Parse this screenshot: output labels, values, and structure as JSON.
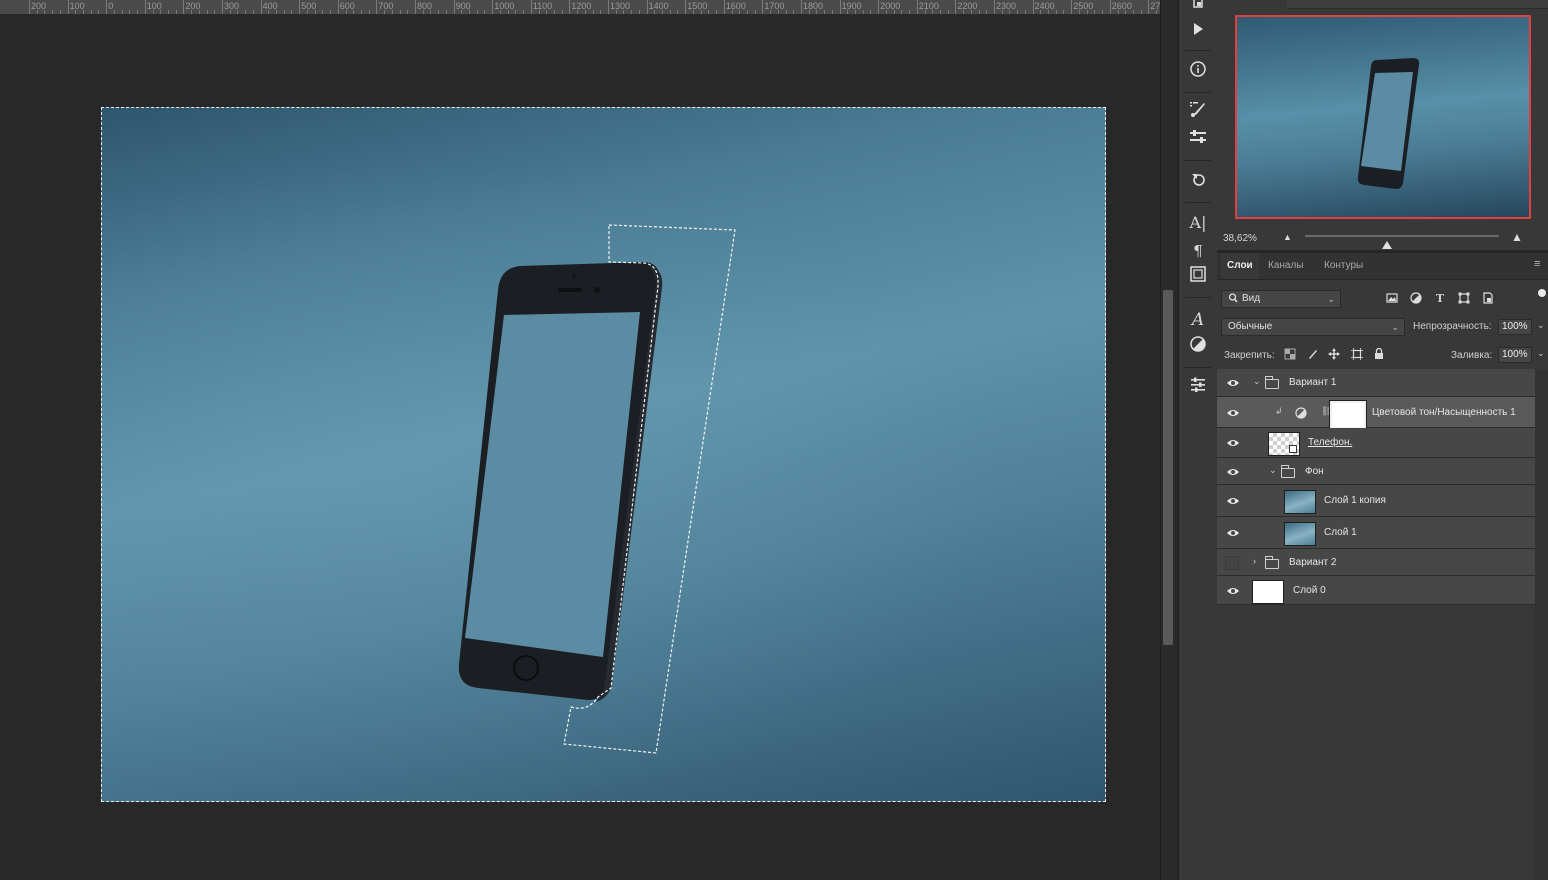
{
  "ruler": {
    "labels": [
      "200",
      "100",
      "0",
      "100",
      "200",
      "300",
      "400",
      "500",
      "600",
      "700",
      "800",
      "900",
      "1000",
      "1100",
      "1200",
      "1300",
      "1400",
      "1500",
      "1600",
      "1700",
      "1800",
      "1900",
      "2000",
      "2100",
      "2200",
      "2300",
      "2400",
      "2500",
      "2600",
      "270"
    ]
  },
  "colors": {
    "background_gradient_top": "#2e566e",
    "background_gradient_mid": "#5e93aa",
    "phone_body": "#1b1f24",
    "navigator_frame": "#e04040",
    "panel_bg": "#383838",
    "selected_layer": "#5a5a5a"
  },
  "icon_strip": [
    "history-brush-icon",
    "play-icon",
    "info-icon",
    "brush-presets-icon",
    "adjust-sliders-icon",
    "clone-source-icon",
    "character-icon",
    "paragraph-icon",
    "glyphs-icon",
    "character-styles-icon",
    "adjustments-icon",
    "properties-icon"
  ],
  "navigator": {
    "zoom": "38,62%"
  },
  "tabs": [
    "Слои",
    "Каналы",
    "Контуры"
  ],
  "filter": {
    "kind_label": "Вид"
  },
  "blend": {
    "mode": "Обычные",
    "opacity_label": "Непрозрачность:",
    "opacity_value": "100%"
  },
  "lock": {
    "label": "Закрепить:",
    "fill_label": "Заливка:",
    "fill_value": "100%"
  },
  "layers": [
    {
      "name": "Вариант 1",
      "type": "group",
      "visible": true,
      "expanded": true
    },
    {
      "name": "Цветовой тон/Насыщенность 1",
      "type": "adjustment",
      "visible": true,
      "selected": true
    },
    {
      "name": "Телефон.",
      "type": "smart-object",
      "visible": true
    },
    {
      "name": "Фон",
      "type": "group",
      "visible": true,
      "expanded": true
    },
    {
      "name": "Слой 1 копия",
      "type": "pixel",
      "visible": true
    },
    {
      "name": "Слой 1",
      "type": "pixel",
      "visible": true
    },
    {
      "name": "Вариант 2",
      "type": "group",
      "visible": false,
      "expanded": false
    },
    {
      "name": "Слой 0",
      "type": "pixel",
      "visible": true
    }
  ]
}
